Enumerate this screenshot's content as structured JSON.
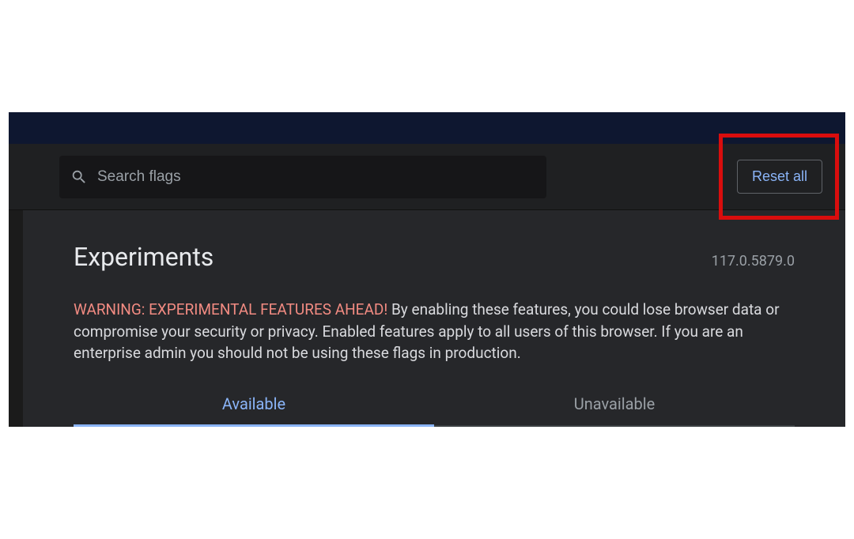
{
  "toolbar": {
    "search_placeholder": "Search flags",
    "reset_label": "Reset all"
  },
  "main": {
    "title": "Experiments",
    "version": "117.0.5879.0",
    "warning_prefix": "WARNING: EXPERIMENTAL FEATURES AHEAD!",
    "warning_body": " By enabling these features, you could lose browser data or compromise your security or privacy. Enabled features apply to all users of this browser. If you are an enterprise admin you should not be using these flags in production."
  },
  "tabs": {
    "available": "Available",
    "unavailable": "Unavailable"
  }
}
